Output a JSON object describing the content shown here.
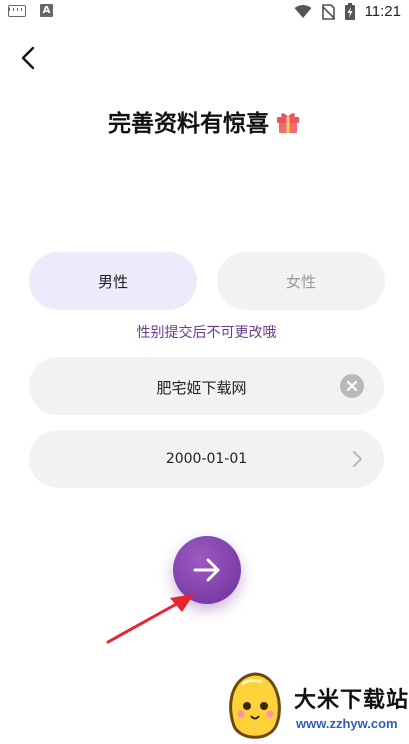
{
  "status_bar": {
    "time": "11:21"
  },
  "header": {
    "title": "完善资料有惊喜"
  },
  "gender": {
    "male_label": "男性",
    "female_label": "女性",
    "note": "性别提交后不可更改哦"
  },
  "form": {
    "nickname_value": "肥宅姬下载网",
    "birthday_value": "2000-01-01"
  },
  "watermark": {
    "title": "大米下载站",
    "url": "www.zzhyw.com"
  },
  "colors": {
    "accent": "#7b3aa8",
    "male_bg": "#ebebfb",
    "field_bg": "#f2f2f2",
    "annotation": "#e8242a"
  }
}
